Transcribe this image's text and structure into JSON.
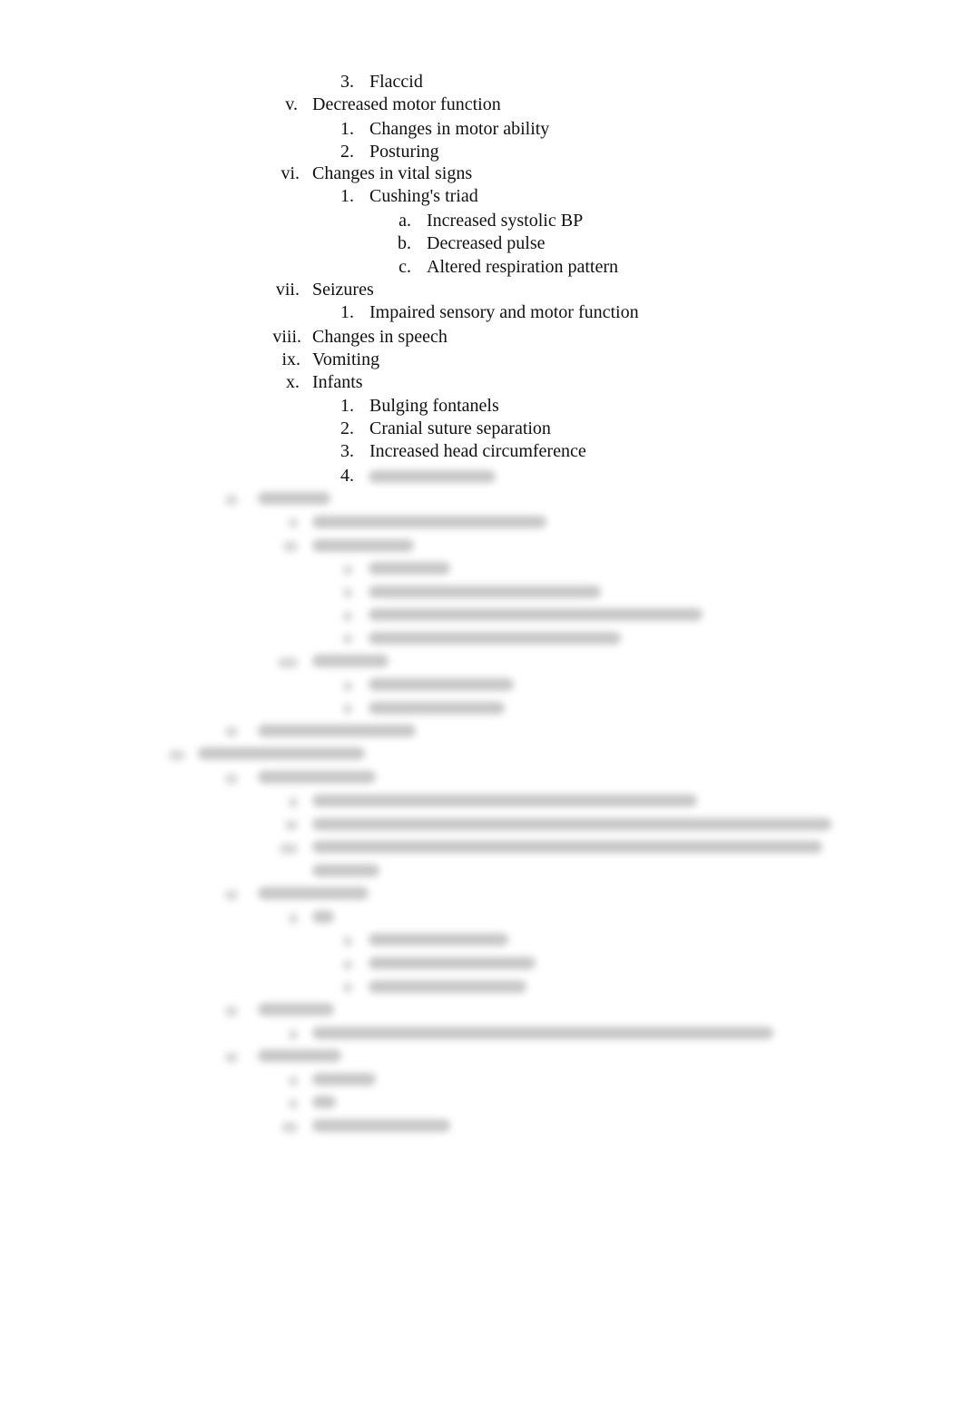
{
  "document": {
    "outline": [
      {
        "marker": "3.",
        "text": "Flaccid",
        "level": 3
      },
      {
        "marker": "v.",
        "text": "Decreased motor function",
        "level": 2
      },
      {
        "marker": "1.",
        "text": "Changes in motor ability",
        "level": 3
      },
      {
        "marker": "2.",
        "text": "Posturing",
        "level": 3
      },
      {
        "marker": "vi.",
        "text": "Changes in vital signs",
        "level": 2
      },
      {
        "marker": "1.",
        "text": "Cushing's triad",
        "level": 3
      },
      {
        "marker": "a.",
        "text": "Increased systolic BP",
        "level": 4
      },
      {
        "marker": "b.",
        "text": "Decreased pulse",
        "level": 4
      },
      {
        "marker": "c.",
        "text": "Altered respiration pattern",
        "level": 4
      },
      {
        "marker": "vii.",
        "text": "Seizures",
        "level": 2
      },
      {
        "marker": "1.",
        "text": "Impaired sensory and motor function",
        "level": 3
      },
      {
        "marker": "viii.",
        "text": "Changes in speech",
        "level": 2
      },
      {
        "marker": "ix.",
        "text": "Vomiting",
        "level": 2
      },
      {
        "marker": "x.",
        "text": "Infants",
        "level": 2
      },
      {
        "marker": "1.",
        "text": "Bulging fontanels",
        "level": 3
      },
      {
        "marker": "2.",
        "text": "Cranial suture separation",
        "level": 3
      },
      {
        "marker": "3.",
        "text": "Increased head circumference",
        "level": 3
      },
      {
        "marker": "4.",
        "text": "",
        "level": 3,
        "blurred": true
      }
    ],
    "blurred_content_notice": "Remaining content is blurred and not legible"
  }
}
